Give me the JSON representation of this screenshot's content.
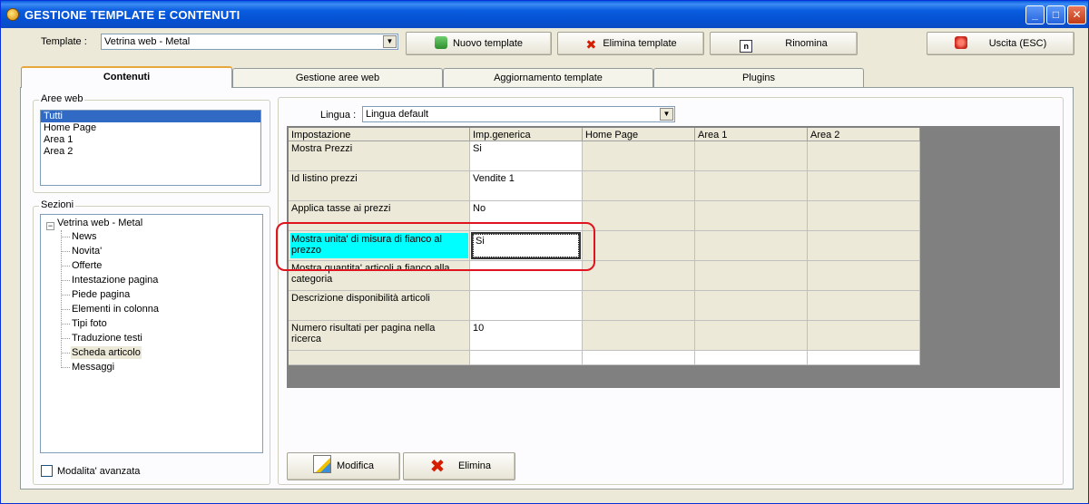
{
  "window": {
    "title": "GESTIONE TEMPLATE E CONTENUTI",
    "min_glyph": "_",
    "max_glyph": "□",
    "close_glyph": "✕"
  },
  "toolbar": {
    "template_label": "Template :",
    "template_value": "Vetrina web - Metal",
    "new_template": "Nuovo template",
    "delete_template": "Elimina template",
    "rename": "Rinomina",
    "exit": "Uscita (ESC)",
    "rename_glyph": "n",
    "delete_glyph": "✖"
  },
  "tabs": [
    "Contenuti",
    "Gestione aree web",
    "Aggiornamento template",
    "Plugins"
  ],
  "aree_web": {
    "caption": "Aree web",
    "items": [
      "Tutti",
      "Home Page",
      "Area 1",
      "Area 2"
    ]
  },
  "sezioni": {
    "caption": "Sezioni",
    "root": "Vetrina web - Metal",
    "items": [
      "News",
      "Novita'",
      "Offerte",
      "Intestazione pagina",
      "Piede pagina",
      "Elementi in colonna",
      "Tipi foto",
      "Traduzione testi",
      "Scheda articolo",
      "Messaggi"
    ],
    "expander": "−"
  },
  "advanced_mode": "Modalita' avanzata",
  "lingua": {
    "label": "Lingua :",
    "value": "Lingua default"
  },
  "grid": {
    "headers": [
      "Impostazione",
      "Imp.generica",
      "Home Page",
      "Area 1",
      "Area 2"
    ],
    "rows": [
      {
        "name": "Mostra Prezzi",
        "value": "Si"
      },
      {
        "name": "Id listino prezzi",
        "value": "Vendite 1"
      },
      {
        "name": "Applica tasse ai prezzi",
        "value": "No"
      },
      {
        "name": "Mostra unita' di misura di fianco al prezzo",
        "value": "Si"
      },
      {
        "name": "Mostra quantita' articoli a fianco alla categoria",
        "value": ""
      },
      {
        "name": "Descrizione disponibilità articoli",
        "value": ""
      },
      {
        "name": "Numero risultati per pagina nella ricerca",
        "value": "10"
      }
    ]
  },
  "actions": {
    "modify": "Modifica",
    "delete": "Elimina",
    "delete_glyph": "✖"
  },
  "colors": {
    "title_blue": "#0a5ddf",
    "selection": "#316ac5",
    "focused_cell": "#00ffff",
    "highlight": "#e0141e"
  }
}
